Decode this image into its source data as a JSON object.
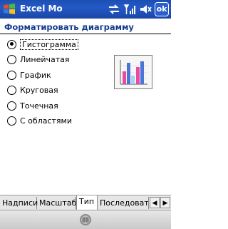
{
  "titlebar": {
    "app_title": "Excel Mo",
    "ok_label": "ok",
    "icons": [
      "windows-start-icon",
      "connectivity-icon",
      "signal-icon",
      "volume-icon"
    ]
  },
  "header": {
    "title": "Форматировать диаграмму"
  },
  "chart_types": [
    {
      "label": "Гистограмма",
      "selected": true
    },
    {
      "label": "Линейчатая",
      "selected": false
    },
    {
      "label": "График",
      "selected": false
    },
    {
      "label": "Круговая",
      "selected": false
    },
    {
      "label": "Точечная",
      "selected": false
    },
    {
      "label": "С областями",
      "selected": false
    }
  ],
  "preview": {
    "icon": "column-chart-preview-icon",
    "colors": [
      "#e84aa0",
      "#4a74d8",
      "#a8d0f0"
    ]
  },
  "tabs": [
    {
      "label": "Надписи",
      "active": false
    },
    {
      "label": "Масштаб",
      "active": false
    },
    {
      "label": "Тип",
      "active": true
    },
    {
      "label": "Последовате",
      "active": false
    }
  ],
  "tab_scroll": {
    "left": "◀",
    "right": "▶"
  },
  "bottombar": {
    "icon": "keyboard-icon"
  }
}
